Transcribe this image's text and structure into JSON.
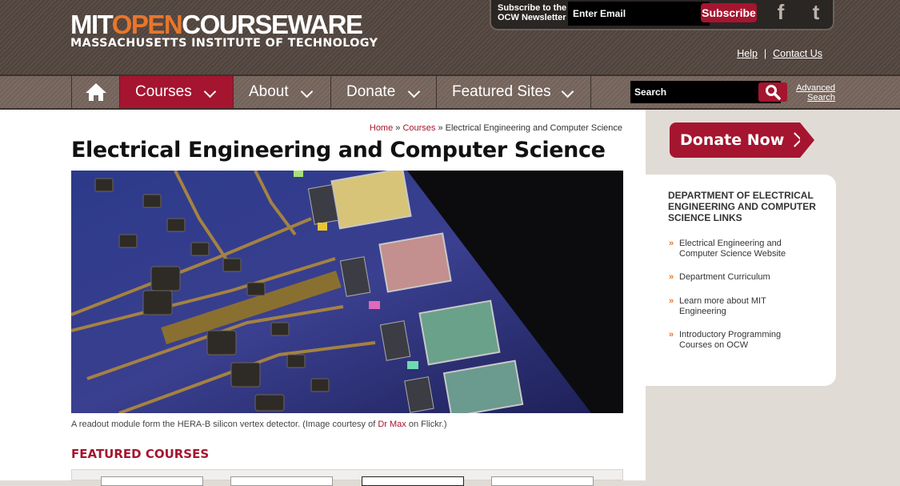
{
  "header": {
    "logo": {
      "part1": "MIT",
      "part2": "OPEN",
      "part3": "COURSEWARE",
      "subtitle": "MASSACHUSETTS INSTITUTE OF TECHNOLOGY"
    },
    "newsletter": {
      "label": "Subscribe to the OCW Newsletter",
      "placeholder": "Enter Email",
      "button": "Subscribe"
    },
    "social": {
      "facebook": "f",
      "twitter": "t"
    },
    "links": {
      "help": "Help",
      "separator": "|",
      "contact": "Contact Us"
    }
  },
  "nav": {
    "items": [
      {
        "label": "Courses"
      },
      {
        "label": "About"
      },
      {
        "label": "Donate"
      },
      {
        "label": "Featured Sites"
      }
    ],
    "search_placeholder": "Search",
    "advanced_search": "Advanced Search"
  },
  "breadcrumb": {
    "home": "Home",
    "sep": " » ",
    "courses": "Courses",
    "current": "Electrical Engineering and Computer Science"
  },
  "page": {
    "title": "Electrical Engineering and Computer Science",
    "caption_prefix": "A readout module form the HERA-B silicon vertex detector. (Image courtesy of ",
    "caption_link": "Dr Max",
    "caption_suffix": " on Flickr.)",
    "featured_heading": "FEATURED COURSES"
  },
  "sidebar": {
    "donate": "Donate Now",
    "heading": "DEPARTMENT OF ELECTRICAL ENGINEERING AND COMPUTER SCIENCE LINKS",
    "links": [
      "Electrical Engineering and Computer Science Website",
      "Department Curriculum",
      "Learn more about MIT Engineering",
      "Introductory Programming Courses on OCW"
    ]
  },
  "colors": {
    "brand": "#a5152f",
    "accent": "#e8762c",
    "header": "#5a4d46"
  }
}
